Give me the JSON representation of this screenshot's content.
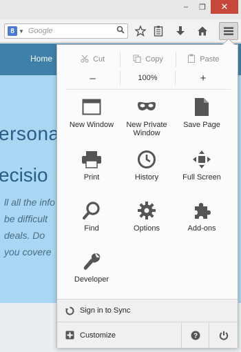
{
  "window_controls": {
    "minimize": "–",
    "restore": "❐",
    "close": "✕"
  },
  "toolbar": {
    "search_engine_badge": "8",
    "search_placeholder": "Google",
    "icons": [
      "bookmark-star-icon",
      "reading-list-icon",
      "download-icon",
      "home-icon",
      "hamburger-menu-icon"
    ]
  },
  "page": {
    "nav_home": "Home",
    "hero_line1": "ersona",
    "hero_line2": "ecisio",
    "body_lines": [
      "ll all the info",
      "be difficult",
      "deals. Do",
      "you covere"
    ]
  },
  "menu": {
    "edit": {
      "cut": "Cut",
      "copy": "Copy",
      "paste": "Paste"
    },
    "zoom": {
      "minus": "–",
      "level": "100%",
      "plus": "+"
    },
    "tiles": [
      {
        "label": "New Window",
        "icon": "window-icon"
      },
      {
        "label": "New Private Window",
        "icon": "mask-icon"
      },
      {
        "label": "Save Page",
        "icon": "page-icon"
      },
      {
        "label": "Print",
        "icon": "printer-icon"
      },
      {
        "label": "History",
        "icon": "clock-icon"
      },
      {
        "label": "Full Screen",
        "icon": "fullscreen-icon"
      },
      {
        "label": "Find",
        "icon": "magnifier-icon"
      },
      {
        "label": "Options",
        "icon": "gear-icon"
      },
      {
        "label": "Add-ons",
        "icon": "puzzle-icon"
      },
      {
        "label": "Developer",
        "icon": "wrench-icon"
      }
    ],
    "sync_label": "Sign in to Sync",
    "customize_label": "Customize"
  },
  "colors": {
    "page_bg": "#a9d6f2",
    "nav_bg": "#3f80a8",
    "close_btn": "#c7473c",
    "icon_gray": "#555555"
  }
}
